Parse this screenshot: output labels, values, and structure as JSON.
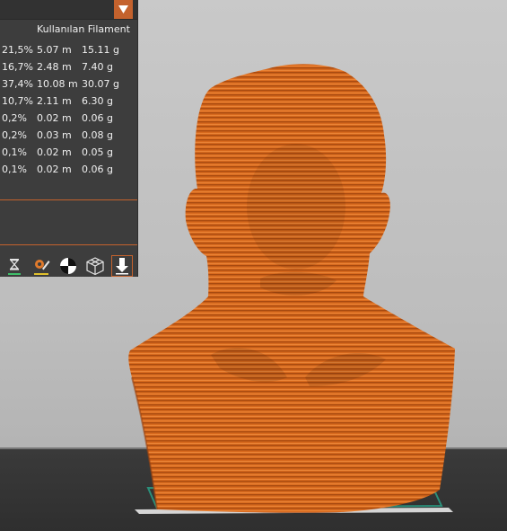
{
  "panel": {
    "column_header": "Kullanılan Filament",
    "rows": [
      {
        "percent": "21,5%",
        "length": "5.07 m",
        "weight": "15.11 g"
      },
      {
        "percent": "16,7%",
        "length": "2.48 m",
        "weight": "7.40 g"
      },
      {
        "percent": "37,4%",
        "length": "10.08 m",
        "weight": "30.07 g"
      },
      {
        "percent": "10,7%",
        "length": "2.11 m",
        "weight": "6.30 g"
      },
      {
        "percent": "0,2%",
        "length": "0.02 m",
        "weight": "0.06 g"
      },
      {
        "percent": "0,2%",
        "length": "0.03 m",
        "weight": "0.08 g"
      },
      {
        "percent": "0,1%",
        "length": "0.02 m",
        "weight": "0.05 g"
      },
      {
        "percent": "0,1%",
        "length": "0.02 m",
        "weight": "0.06 g"
      }
    ]
  },
  "toolbar": {
    "icons": [
      "hourglass-icon",
      "color-print-icon",
      "checker-icon",
      "wireframe-cube-icon",
      "export-icon"
    ]
  },
  "colors": {
    "accent": "#c4622d",
    "model": "#d86a1e",
    "panel_bg": "#3d3d3d"
  }
}
